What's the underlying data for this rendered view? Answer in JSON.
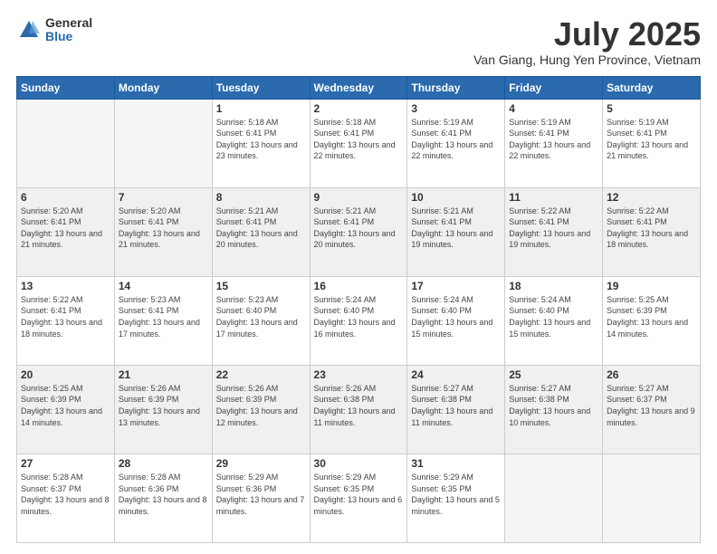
{
  "logo": {
    "general": "General",
    "blue": "Blue"
  },
  "header": {
    "month": "July 2025",
    "location": "Van Giang, Hung Yen Province, Vietnam"
  },
  "weekdays": [
    "Sunday",
    "Monday",
    "Tuesday",
    "Wednesday",
    "Thursday",
    "Friday",
    "Saturday"
  ],
  "weeks": [
    [
      {
        "day": "",
        "sunrise": "",
        "sunset": "",
        "daylight": ""
      },
      {
        "day": "",
        "sunrise": "",
        "sunset": "",
        "daylight": ""
      },
      {
        "day": "1",
        "sunrise": "Sunrise: 5:18 AM",
        "sunset": "Sunset: 6:41 PM",
        "daylight": "Daylight: 13 hours and 23 minutes."
      },
      {
        "day": "2",
        "sunrise": "Sunrise: 5:18 AM",
        "sunset": "Sunset: 6:41 PM",
        "daylight": "Daylight: 13 hours and 22 minutes."
      },
      {
        "day": "3",
        "sunrise": "Sunrise: 5:19 AM",
        "sunset": "Sunset: 6:41 PM",
        "daylight": "Daylight: 13 hours and 22 minutes."
      },
      {
        "day": "4",
        "sunrise": "Sunrise: 5:19 AM",
        "sunset": "Sunset: 6:41 PM",
        "daylight": "Daylight: 13 hours and 22 minutes."
      },
      {
        "day": "5",
        "sunrise": "Sunrise: 5:19 AM",
        "sunset": "Sunset: 6:41 PM",
        "daylight": "Daylight: 13 hours and 21 minutes."
      }
    ],
    [
      {
        "day": "6",
        "sunrise": "Sunrise: 5:20 AM",
        "sunset": "Sunset: 6:41 PM",
        "daylight": "Daylight: 13 hours and 21 minutes."
      },
      {
        "day": "7",
        "sunrise": "Sunrise: 5:20 AM",
        "sunset": "Sunset: 6:41 PM",
        "daylight": "Daylight: 13 hours and 21 minutes."
      },
      {
        "day": "8",
        "sunrise": "Sunrise: 5:21 AM",
        "sunset": "Sunset: 6:41 PM",
        "daylight": "Daylight: 13 hours and 20 minutes."
      },
      {
        "day": "9",
        "sunrise": "Sunrise: 5:21 AM",
        "sunset": "Sunset: 6:41 PM",
        "daylight": "Daylight: 13 hours and 20 minutes."
      },
      {
        "day": "10",
        "sunrise": "Sunrise: 5:21 AM",
        "sunset": "Sunset: 6:41 PM",
        "daylight": "Daylight: 13 hours and 19 minutes."
      },
      {
        "day": "11",
        "sunrise": "Sunrise: 5:22 AM",
        "sunset": "Sunset: 6:41 PM",
        "daylight": "Daylight: 13 hours and 19 minutes."
      },
      {
        "day": "12",
        "sunrise": "Sunrise: 5:22 AM",
        "sunset": "Sunset: 6:41 PM",
        "daylight": "Daylight: 13 hours and 18 minutes."
      }
    ],
    [
      {
        "day": "13",
        "sunrise": "Sunrise: 5:22 AM",
        "sunset": "Sunset: 6:41 PM",
        "daylight": "Daylight: 13 hours and 18 minutes."
      },
      {
        "day": "14",
        "sunrise": "Sunrise: 5:23 AM",
        "sunset": "Sunset: 6:41 PM",
        "daylight": "Daylight: 13 hours and 17 minutes."
      },
      {
        "day": "15",
        "sunrise": "Sunrise: 5:23 AM",
        "sunset": "Sunset: 6:40 PM",
        "daylight": "Daylight: 13 hours and 17 minutes."
      },
      {
        "day": "16",
        "sunrise": "Sunrise: 5:24 AM",
        "sunset": "Sunset: 6:40 PM",
        "daylight": "Daylight: 13 hours and 16 minutes."
      },
      {
        "day": "17",
        "sunrise": "Sunrise: 5:24 AM",
        "sunset": "Sunset: 6:40 PM",
        "daylight": "Daylight: 13 hours and 15 minutes."
      },
      {
        "day": "18",
        "sunrise": "Sunrise: 5:24 AM",
        "sunset": "Sunset: 6:40 PM",
        "daylight": "Daylight: 13 hours and 15 minutes."
      },
      {
        "day": "19",
        "sunrise": "Sunrise: 5:25 AM",
        "sunset": "Sunset: 6:39 PM",
        "daylight": "Daylight: 13 hours and 14 minutes."
      }
    ],
    [
      {
        "day": "20",
        "sunrise": "Sunrise: 5:25 AM",
        "sunset": "Sunset: 6:39 PM",
        "daylight": "Daylight: 13 hours and 14 minutes."
      },
      {
        "day": "21",
        "sunrise": "Sunrise: 5:26 AM",
        "sunset": "Sunset: 6:39 PM",
        "daylight": "Daylight: 13 hours and 13 minutes."
      },
      {
        "day": "22",
        "sunrise": "Sunrise: 5:26 AM",
        "sunset": "Sunset: 6:39 PM",
        "daylight": "Daylight: 13 hours and 12 minutes."
      },
      {
        "day": "23",
        "sunrise": "Sunrise: 5:26 AM",
        "sunset": "Sunset: 6:38 PM",
        "daylight": "Daylight: 13 hours and 11 minutes."
      },
      {
        "day": "24",
        "sunrise": "Sunrise: 5:27 AM",
        "sunset": "Sunset: 6:38 PM",
        "daylight": "Daylight: 13 hours and 11 minutes."
      },
      {
        "day": "25",
        "sunrise": "Sunrise: 5:27 AM",
        "sunset": "Sunset: 6:38 PM",
        "daylight": "Daylight: 13 hours and 10 minutes."
      },
      {
        "day": "26",
        "sunrise": "Sunrise: 5:27 AM",
        "sunset": "Sunset: 6:37 PM",
        "daylight": "Daylight: 13 hours and 9 minutes."
      }
    ],
    [
      {
        "day": "27",
        "sunrise": "Sunrise: 5:28 AM",
        "sunset": "Sunset: 6:37 PM",
        "daylight": "Daylight: 13 hours and 8 minutes."
      },
      {
        "day": "28",
        "sunrise": "Sunrise: 5:28 AM",
        "sunset": "Sunset: 6:36 PM",
        "daylight": "Daylight: 13 hours and 8 minutes."
      },
      {
        "day": "29",
        "sunrise": "Sunrise: 5:29 AM",
        "sunset": "Sunset: 6:36 PM",
        "daylight": "Daylight: 13 hours and 7 minutes."
      },
      {
        "day": "30",
        "sunrise": "Sunrise: 5:29 AM",
        "sunset": "Sunset: 6:35 PM",
        "daylight": "Daylight: 13 hours and 6 minutes."
      },
      {
        "day": "31",
        "sunrise": "Sunrise: 5:29 AM",
        "sunset": "Sunset: 6:35 PM",
        "daylight": "Daylight: 13 hours and 5 minutes."
      },
      {
        "day": "",
        "sunrise": "",
        "sunset": "",
        "daylight": ""
      },
      {
        "day": "",
        "sunrise": "",
        "sunset": "",
        "daylight": ""
      }
    ]
  ]
}
